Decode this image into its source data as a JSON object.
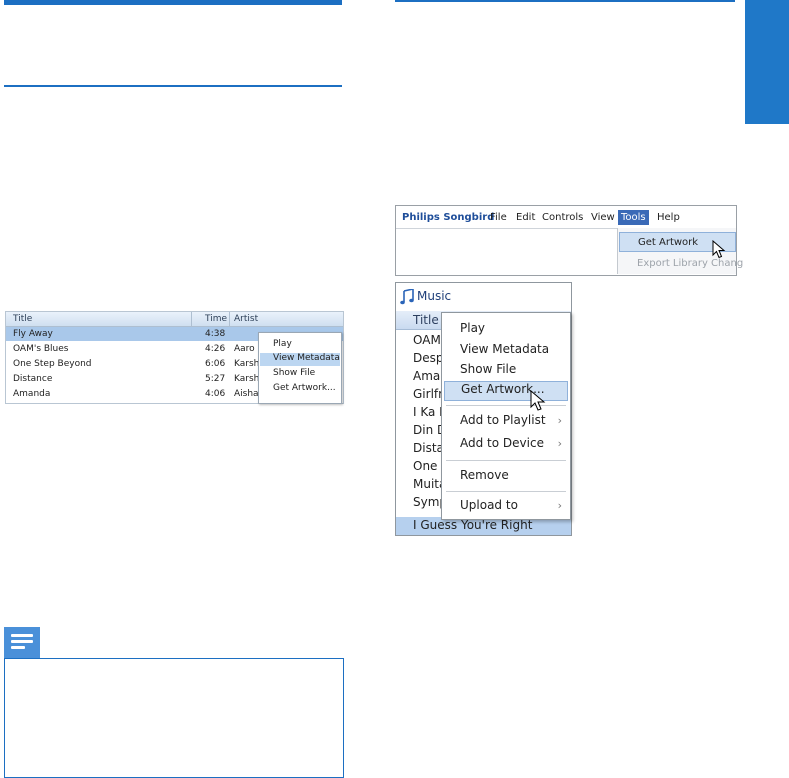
{
  "small_library": {
    "columns": [
      "Title",
      "Time",
      "Artist"
    ],
    "rows": [
      {
        "title": "Fly Away",
        "time": "4:38",
        "artist": ""
      },
      {
        "title": "OAM's Blues",
        "time": "4:26",
        "artist": "Aaro"
      },
      {
        "title": "One Step Beyond",
        "time": "6:06",
        "artist": "Karsh"
      },
      {
        "title": "Distance",
        "time": "5:27",
        "artist": "Karsh"
      },
      {
        "title": "Amanda",
        "time": "4:06",
        "artist": "Aisha"
      }
    ],
    "context_menu": [
      "Play",
      "View Metadata",
      "Show File",
      "Get Artwork..."
    ]
  },
  "menu_bar": {
    "brand": "Philips Songbird",
    "items": [
      "File",
      "Edit",
      "Controls",
      "View",
      "Tools",
      "Help"
    ],
    "tools_menu": [
      "Get Artwork",
      "Export Library Chang"
    ]
  },
  "music_window": {
    "title": "Music",
    "column": "Title",
    "tracks": [
      "OAM",
      "Desp",
      "Amar",
      "Girlfr",
      "I Ka B",
      "Din D",
      "Dista",
      "One S",
      "Muita",
      "Symp"
    ],
    "selected_track": "I Guess You're Right",
    "context_menu": {
      "play": "Play",
      "view_metadata": "View Metadata",
      "show_file": "Show File",
      "get_artwork": "Get Artwork...",
      "add_to_playlist": "Add to Playlist",
      "add_to_device": "Add to Device",
      "remove": "Remove",
      "upload_to": "Upload to"
    }
  },
  "colors": {
    "accent": "#1c6fc2",
    "tab": "#1f78c8",
    "highlight": "#cfe0f3",
    "note_icon": "#4a90d9"
  },
  "icons": [
    "music-note-icon",
    "cursor-arrow-icon",
    "submenu-arrow-icon",
    "note-icon"
  ]
}
